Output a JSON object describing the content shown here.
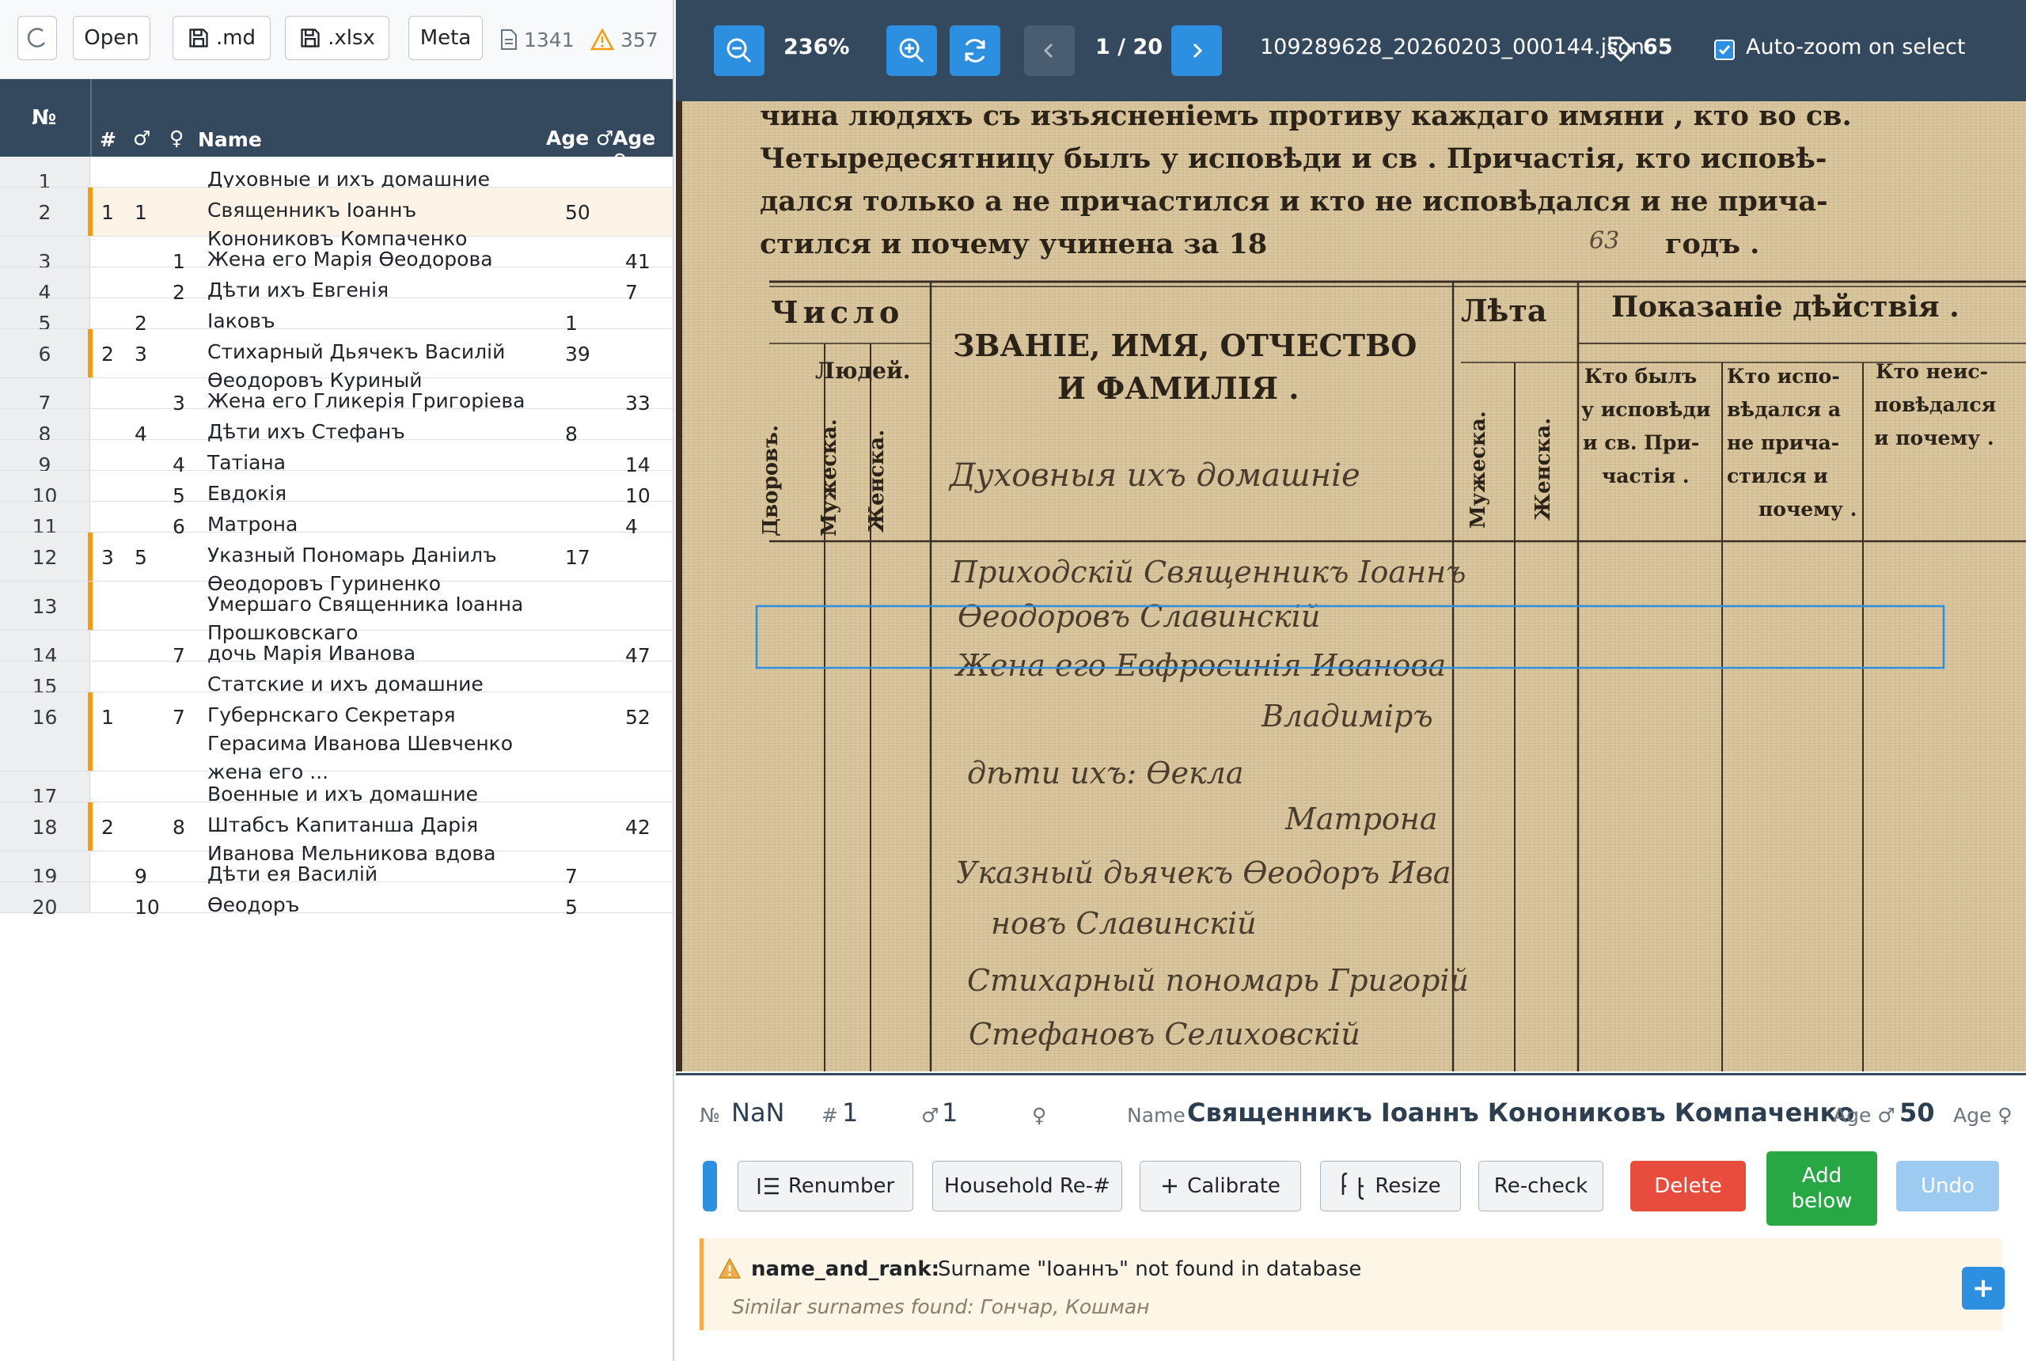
{
  "toolbar": {
    "open_label": "Open",
    "md_label": ".md",
    "xlsx_label": ".xlsx",
    "meta_label": "Meta",
    "doc_count": "1341",
    "warn_count": "357"
  },
  "table": {
    "columns": {
      "num": "№",
      "household": "#",
      "male": "♂",
      "female": "♀",
      "name": "Name",
      "age_male": "Age ♂",
      "age_female": "Age ♀"
    },
    "rows": [
      {
        "n": "1",
        "h": "",
        "m": "",
        "f": "",
        "name": "Духовные и ихъ домашние",
        "am": "",
        "af": ""
      },
      {
        "n": "2",
        "h": "1",
        "m": "1",
        "f": "",
        "name": "Священникъ Іоаннъ Конониковъ Компаченко",
        "am": "50",
        "af": ""
      },
      {
        "n": "3",
        "h": "",
        "m": "",
        "f": "1",
        "name": "Жена его Марія Өеодорова",
        "am": "",
        "af": "41"
      },
      {
        "n": "4",
        "h": "",
        "m": "",
        "f": "2",
        "name": "Дѣти ихъ Евгенія",
        "am": "",
        "af": "7"
      },
      {
        "n": "5",
        "h": "",
        "m": "2",
        "f": "",
        "name": "Іаковъ",
        "am": "1",
        "af": ""
      },
      {
        "n": "6",
        "h": "2",
        "m": "3",
        "f": "",
        "name": "Стихарный Дьячекъ Василій Өеодоровъ Куриный",
        "am": "39",
        "af": ""
      },
      {
        "n": "7",
        "h": "",
        "m": "",
        "f": "3",
        "name": "Жена его Гликерія Григоріева",
        "am": "",
        "af": "33"
      },
      {
        "n": "8",
        "h": "",
        "m": "4",
        "f": "",
        "name": "Дѣти ихъ Стефанъ",
        "am": "8",
        "af": ""
      },
      {
        "n": "9",
        "h": "",
        "m": "",
        "f": "4",
        "name": "Татіана",
        "am": "",
        "af": "14"
      },
      {
        "n": "10",
        "h": "",
        "m": "",
        "f": "5",
        "name": "Евдокія",
        "am": "",
        "af": "10"
      },
      {
        "n": "11",
        "h": "",
        "m": "",
        "f": "6",
        "name": "Матрона",
        "am": "",
        "af": "4"
      },
      {
        "n": "12",
        "h": "3",
        "m": "5",
        "f": "",
        "name": "Указный Пономарь Даніилъ Өеодоровъ Гуриненко",
        "am": "17",
        "af": ""
      },
      {
        "n": "13",
        "h": "",
        "m": "",
        "f": "",
        "name": "Умершаго Священника Іоанна Прошковскаго",
        "am": "",
        "af": ""
      },
      {
        "n": "14",
        "h": "",
        "m": "",
        "f": "7",
        "name": "дочь Марія Иванова",
        "am": "",
        "af": "47"
      },
      {
        "n": "15",
        "h": "",
        "m": "",
        "f": "",
        "name": "Статские и ихъ домашние",
        "am": "",
        "af": ""
      },
      {
        "n": "16",
        "h": "1",
        "m": "",
        "f": "7",
        "name": "Губернскаго Секретаря Герасима Иванова Шевченко жена его ...",
        "am": "",
        "af": "52"
      },
      {
        "n": "17",
        "h": "",
        "m": "",
        "f": "",
        "name": "Военные и ихъ домашние",
        "am": "",
        "af": ""
      },
      {
        "n": "18",
        "h": "2",
        "m": "",
        "f": "8",
        "name": "Штабсъ Капитанша Дарія Иванова Мельникова вдова",
        "am": "",
        "af": "42"
      },
      {
        "n": "19",
        "h": "",
        "m": "9",
        "f": "",
        "name": "Дѣти ея Василій",
        "am": "7",
        "af": ""
      },
      {
        "n": "20",
        "h": "",
        "m": "10",
        "f": "",
        "name": "Өеодоръ",
        "am": "5",
        "af": ""
      }
    ]
  },
  "viewer_toolbar": {
    "zoom": "236%",
    "page": "1 / 20",
    "filename": "109289628_20260203_000144.json",
    "tag_count": "65",
    "autozoom_label": "Auto-zoom on select",
    "autozoom_checked": true
  },
  "document": {
    "header_lines": [
      "чина людяхъ съ изъясненіемъ противу каждаго имяни , кто во св.",
      "Четыредесятницу былъ у исповѣди и св . Причастія, кто исповѣ-",
      "дался только а не причастился и кто не исповѣдался и не прича-",
      "стился и почему учинена за 18",
      "годъ ."
    ],
    "year_suffix": "63",
    "col_chislo": "Число",
    "col_lyudei": "Людей.",
    "col_dvorov": "Дворовъ.",
    "col_muzh": "Мужеска.",
    "col_zhen": "Женска.",
    "col_zvanie_1": "ЗВАНІЕ, ИМЯ, ОТЧЕСТВО",
    "col_zvanie_2": "И ФАМИЛІЯ .",
    "col_leta": "Лѣта",
    "col_leta_muzh": "Мужеска.",
    "col_leta_zhen": "Женска.",
    "col_pokazanie": "Показаніе дѣйствія .",
    "col_kto_byl": [
      "Кто былъ",
      "у исповѣди",
      "и св. При-",
      "частія ."
    ],
    "col_kto_isp": [
      "Кто испо-",
      "вѣдался а",
      "не прича-",
      "стился и",
      "почему ."
    ],
    "col_kto_ne": [
      "Кто неис-",
      "повѣдался",
      "и почему ."
    ],
    "hand_lines": [
      "Духовныя ихъ домашніе",
      "Приходскій Священникъ Іоаннъ",
      "Өеодоровъ Славинскій",
      "Жена его Евфросинія Иванова",
      "Владиміръ",
      "дѣти ихъ: Ѳекла",
      "Матрона",
      "Указный дьячекъ Өеодоръ Ива",
      "новъ Славинскій",
      "Стихарный пономарь Григорій",
      "Стефановъ Селиховскій"
    ]
  },
  "detail": {
    "num_label": "№",
    "num_value": "NaN",
    "household_label": "#",
    "household_value": "1",
    "male_label": "♂",
    "male_value": "1",
    "female_label": "♀",
    "female_value": "",
    "name_label": "Name",
    "name_value": "Священникъ Іоаннъ Конониковъ Компаченко",
    "age_m_label": "Age ♂",
    "age_m_value": "50",
    "age_f_label": "Age ♀",
    "age_f_value": ""
  },
  "actions": {
    "renumber": "Renumber",
    "household_renum": "Household Re-#",
    "calibrate": "Calibrate",
    "resize": "Resize",
    "recheck": "Re-check",
    "delete": "Delete",
    "add_below_1": "Add",
    "add_below_2": "below",
    "undo": "Undo"
  },
  "issue": {
    "field": "name_and_rank:",
    "message": "Surname \"Іоаннъ\" not found in database",
    "suggestion": "Similar surnames found: Гончар, Кошман",
    "add_label": "+"
  },
  "colors": {
    "header_bg": "#34495e",
    "accent_blue": "#2d8fe0",
    "warning": "#f39c12",
    "delete_red": "#e74c3c",
    "add_green": "#28a745",
    "selected_row": "#fdf3e6"
  }
}
